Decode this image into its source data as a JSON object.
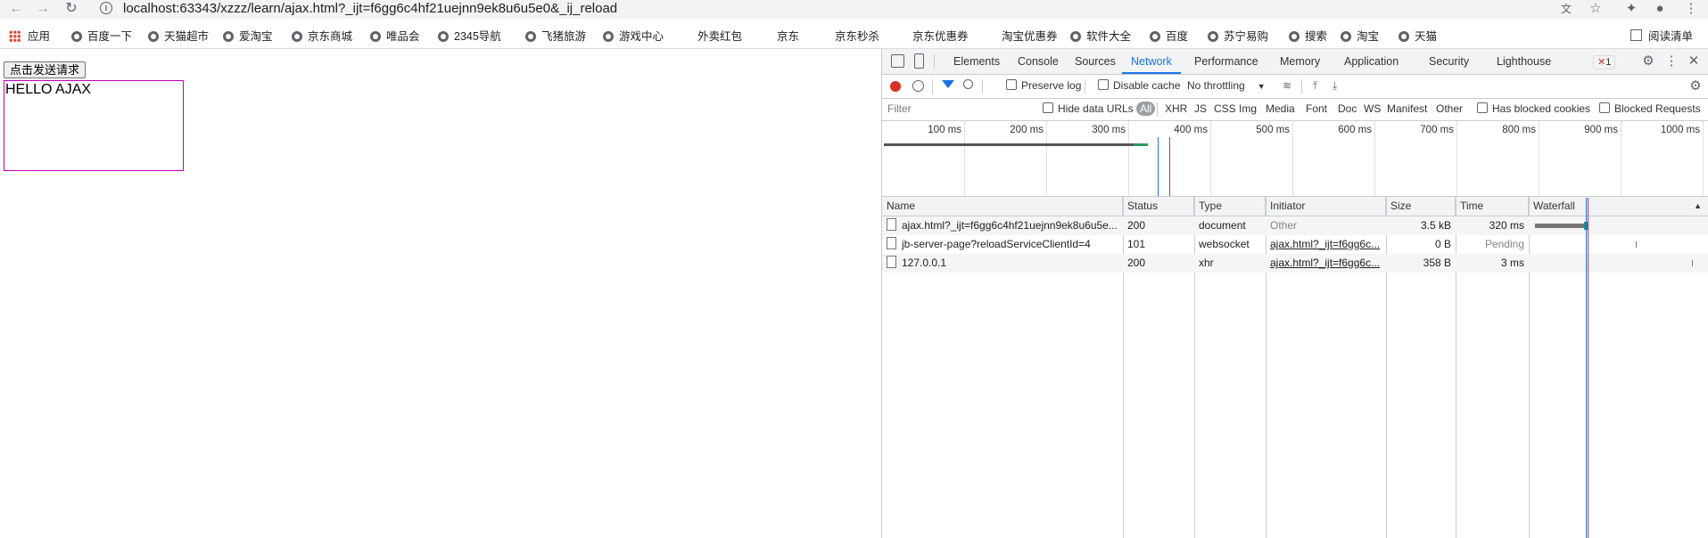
{
  "browser": {
    "url": "localhost:63343/xzzz/learn/ajax.html?_ijt=f6gg6c4hf21uejnn9ek8u6u5e0&_ij_reload",
    "reading_list": "阅读清单"
  },
  "bookmarks": {
    "apps": "应用",
    "items": [
      "百度一下",
      "天猫超市",
      "爱淘宝",
      "京东商城",
      "唯品会",
      "2345导航",
      "飞猪旅游",
      "游戏中心",
      "外卖红包",
      "京东",
      "京东秒杀",
      "京东优惠券",
      "淘宝优惠券",
      "软件大全",
      "百度",
      "苏宁易购",
      "搜索",
      "淘宝",
      "天猫"
    ]
  },
  "page": {
    "button_label": "点击发送请求",
    "box_text": "HELLO AJAX"
  },
  "devtools": {
    "tabs": [
      "Elements",
      "Console",
      "Sources",
      "Network",
      "Performance",
      "Memory",
      "Application",
      "Security",
      "Lighthouse"
    ],
    "active_tab": "Network",
    "error_count": "1",
    "toolbar": {
      "preserve_log": "Preserve log",
      "disable_cache": "Disable cache",
      "throttling": "No throttling"
    },
    "filter": {
      "placeholder": "Filter",
      "hide_data_urls": "Hide data URLs",
      "types": [
        "All",
        "XHR",
        "JS",
        "CSS",
        "Img",
        "Media",
        "Font",
        "Doc",
        "WS",
        "Manifest",
        "Other"
      ],
      "active_type": "All",
      "has_blocked_cookies": "Has blocked cookies",
      "blocked_requests": "Blocked Requests"
    },
    "overview_ticks": [
      "100 ms",
      "200 ms",
      "300 ms",
      "400 ms",
      "500 ms",
      "600 ms",
      "700 ms",
      "800 ms",
      "900 ms",
      "1000 ms"
    ],
    "columns": [
      "Name",
      "Status",
      "Type",
      "Initiator",
      "Size",
      "Time",
      "Waterfall"
    ],
    "requests": [
      {
        "name": "ajax.html?_ijt=f6gg6c4hf21uejnn9ek8u6u5e...",
        "status": "200",
        "type": "document",
        "initiator": "Other",
        "size": "3.5 kB",
        "time": "320 ms"
      },
      {
        "name": "jb-server-page?reloadServiceClientId=4",
        "status": "101",
        "type": "websocket",
        "initiator": "ajax.html?_ijt=f6gg6c...",
        "size": "0 B",
        "time": "Pending"
      },
      {
        "name": "127.0.0.1",
        "status": "200",
        "type": "xhr",
        "initiator": "ajax.html?_ijt=f6gg6c...",
        "size": "358 B",
        "time": "3 ms"
      }
    ]
  },
  "colors": {
    "accent": "#1a73e8",
    "record": "#d93025",
    "box_border": "#c000c0"
  }
}
